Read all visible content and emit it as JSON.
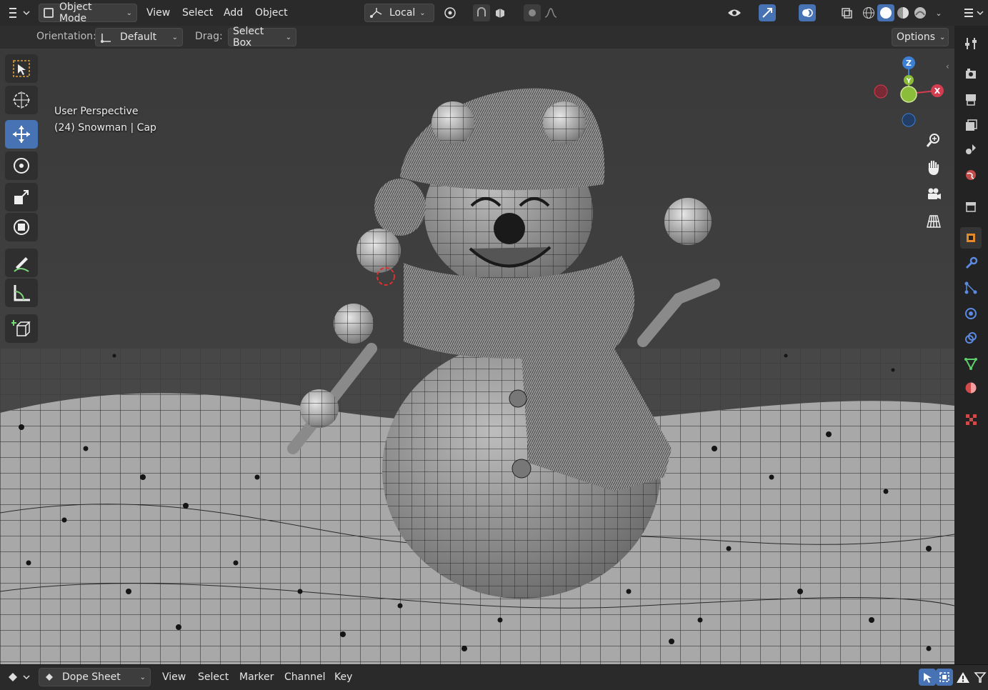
{
  "header": {
    "mode_label": "Object Mode",
    "menu": [
      "View",
      "Select",
      "Add",
      "Object"
    ],
    "transform_pivot_label": "Local"
  },
  "subbar": {
    "orientation_label": "Orientation:",
    "orientation_value": "Default",
    "drag_label": "Drag:",
    "drag_value": "Select Box",
    "options_label": "Options"
  },
  "viewport": {
    "view_name": "User Perspective",
    "object_info": "(24) Snowman | Cap"
  },
  "gizmo": {
    "x": "X",
    "y": "Y",
    "z": "Z"
  },
  "footer": {
    "editor_label": "Dope Sheet",
    "menu": [
      "View",
      "Select",
      "Marker",
      "Channel",
      "Key"
    ]
  },
  "colors": {
    "accent": "#4772b3",
    "axis_x": "#d43c50",
    "axis_y": "#8bbd3a",
    "axis_z": "#3c7fd4"
  }
}
